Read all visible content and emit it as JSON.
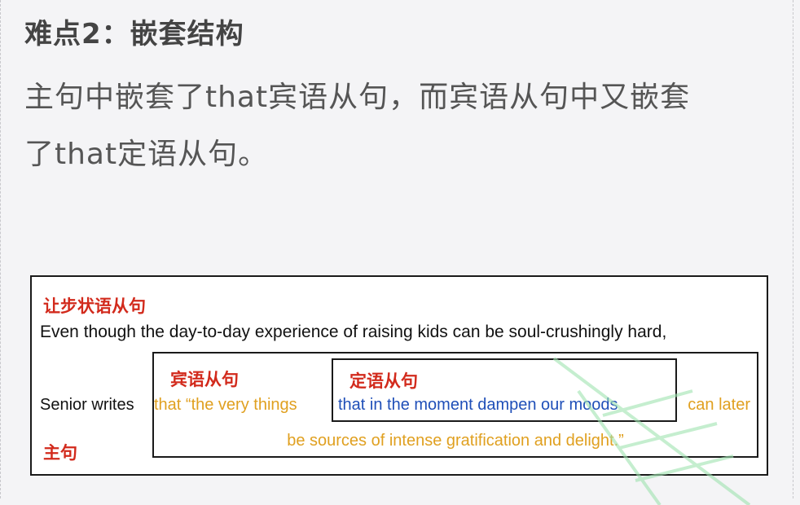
{
  "heading": "难点2：嵌套结构",
  "description": {
    "line1": "主句中嵌套了that宾语从句，而宾语从句中又嵌套",
    "line2": "了that定语从句。"
  },
  "diagram": {
    "concession_label": "让步状语从句",
    "concession_text": "Even though the day-to-day experience of raising kids can be soul-crushingly hard,",
    "main_label": "主句",
    "main_text": "Senior writes",
    "object_clause": {
      "label": "宾语从句",
      "text_before": "that “the very things",
      "text_after": "can later",
      "text_line2": "be sources of intense gratification and delight.”",
      "color": "#e0a020"
    },
    "attributive_clause": {
      "label": "定语从句",
      "text": "that in the moment dampen our moods",
      "color": "#1f4fb8"
    },
    "label_color": "#d22a1c"
  }
}
